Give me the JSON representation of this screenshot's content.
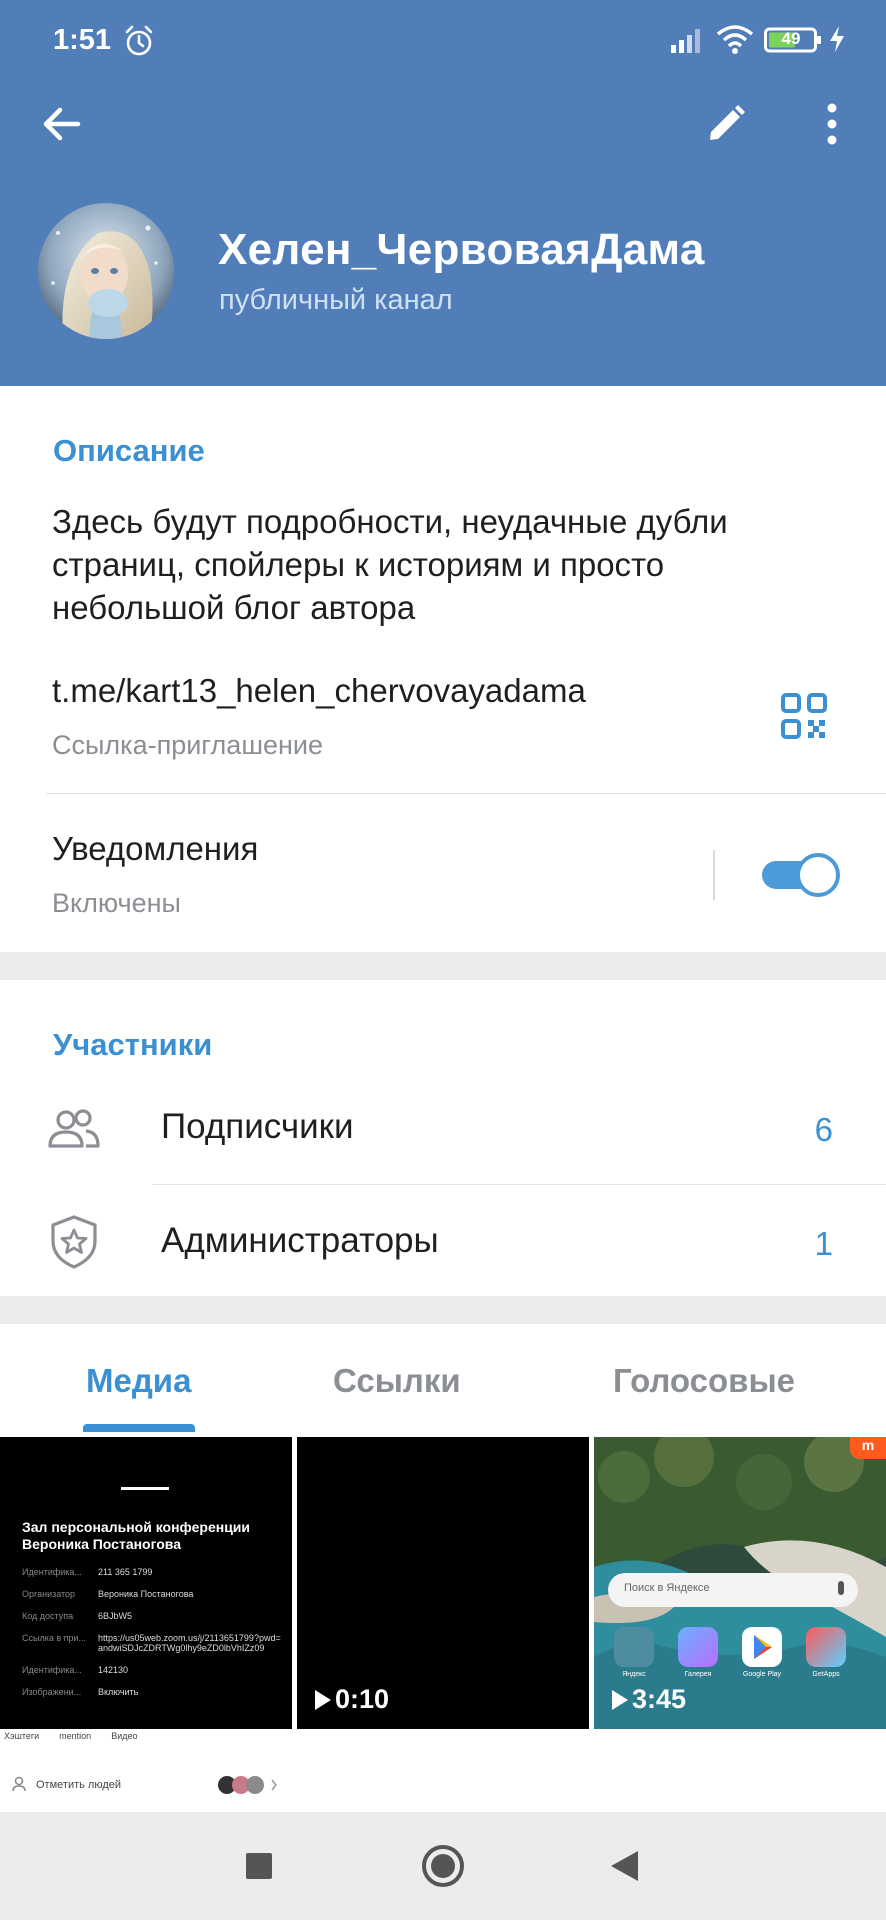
{
  "status_bar": {
    "time": "1:51",
    "battery": "49",
    "icons": [
      "alarm-icon",
      "signal-icon",
      "wifi-icon",
      "battery-icon",
      "charging-icon"
    ]
  },
  "toolbar": {
    "icons": [
      "back-arrow-icon",
      "edit-pencil-icon",
      "more-vertical-icon"
    ]
  },
  "channel": {
    "name": "Хелен_ЧервоваяДама",
    "type": "публичный канал"
  },
  "info": {
    "description_title": "Описание",
    "description": "Здесь будут подробности, неудачные дубли страниц, спойлеры к историям и просто небольшой блог автора",
    "link": "t.me/kart13_helen_chervovayadama",
    "link_caption": "Ссылка-приглашение",
    "notifications_label": "Уведомления",
    "notifications_state": "Включены",
    "notifications_on": true
  },
  "members": {
    "title": "Участники",
    "subscribers_label": "Подписчики",
    "subscribers_count": "6",
    "admins_label": "Администраторы",
    "admins_count": "1"
  },
  "media_tabs": {
    "media": "Медиа",
    "links": "Ссылки",
    "voice": "Голосовые"
  },
  "thumbnails": {
    "t1_title": "Зал персональной конференции Вероника Постаногова",
    "t1_rows": [
      {
        "k": "Идентифика...",
        "v": "211 365 1799"
      },
      {
        "k": "Организатор",
        "v": "Вероника Постаногова"
      },
      {
        "k": "Код доступа",
        "v": "6BJbW5"
      },
      {
        "k": "Ссылка в при...",
        "v": "https://us05web.zoom.us/j/2113651799?pwd=andwiSDJcZDRTWg0lhy9eZD0lbVhIZz09"
      },
      {
        "k": "Идентифика...",
        "v": "142130"
      },
      {
        "k": "Изображени...",
        "v": "Включить"
      }
    ],
    "t2_duration": "0:10",
    "t3_duration": "3:45",
    "t3_search": "Поиск в Яндексе",
    "t3_apps": [
      "Яндекс",
      "Галерея",
      "Google Play",
      "GetApps"
    ]
  },
  "strip": {
    "chips": [
      "Хэштеги",
      "mention",
      "Видео"
    ],
    "tag_people": "Отметить людей"
  },
  "colors": {
    "header": "#517eb8",
    "accent": "#3b8fd3"
  }
}
